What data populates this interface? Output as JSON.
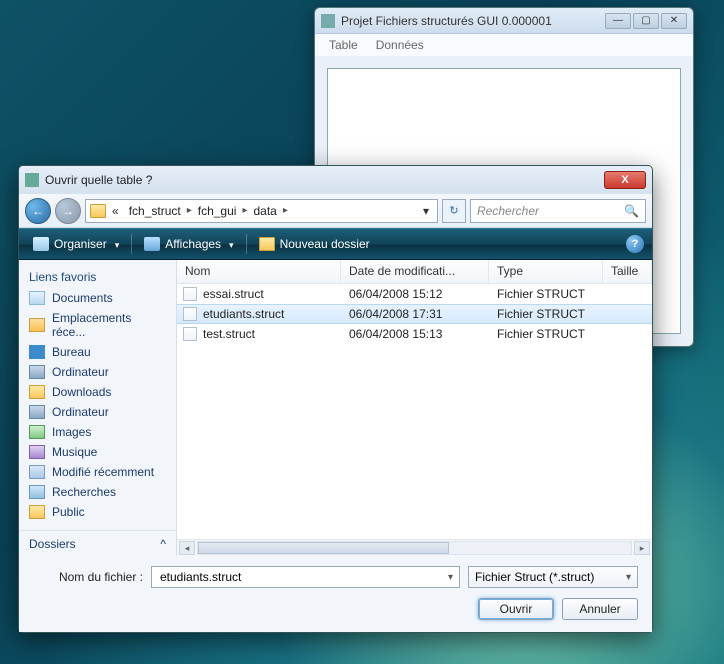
{
  "bg_window": {
    "title": "Projet Fichiers structurés GUI 0.000001",
    "menu_table": "Table",
    "menu_donnees": "Données"
  },
  "dialog": {
    "title": "Ouvrir quelle table ?",
    "breadcrumbs": {
      "pre": "«",
      "p1": "fch_struct",
      "p2": "fch_gui",
      "p3": "data"
    },
    "search_placeholder": "Rechercher",
    "toolbar": {
      "org": "Organiser",
      "views": "Affichages",
      "newfolder": "Nouveau dossier"
    },
    "fav_header": "Liens favoris",
    "favorites": [
      {
        "label": "Documents",
        "ico": "ico-doc"
      },
      {
        "label": "Emplacements réce...",
        "ico": "ico-loc"
      },
      {
        "label": "Bureau",
        "ico": "ico-desk"
      },
      {
        "label": "Ordinateur",
        "ico": "ico-pc"
      },
      {
        "label": "Downloads",
        "ico": "ico-dl"
      },
      {
        "label": "Ordinateur",
        "ico": "ico-pc"
      },
      {
        "label": "Images",
        "ico": "ico-img"
      },
      {
        "label": "Musique",
        "ico": "ico-mus"
      },
      {
        "label": "Modifié récemment",
        "ico": "ico-rec"
      },
      {
        "label": "Recherches",
        "ico": "ico-srch"
      },
      {
        "label": "Public",
        "ico": "ico-pub"
      }
    ],
    "dossiers": "Dossiers",
    "columns": {
      "name": "Nom",
      "date": "Date de modificati...",
      "type": "Type",
      "size": "Taille"
    },
    "files": [
      {
        "name": "essai.struct",
        "date": "06/04/2008 15:12",
        "type": "Fichier STRUCT",
        "selected": false
      },
      {
        "name": "etudiants.struct",
        "date": "06/04/2008 17:31",
        "type": "Fichier STRUCT",
        "selected": true
      },
      {
        "name": "test.struct",
        "date": "06/04/2008 15:13",
        "type": "Fichier STRUCT",
        "selected": false
      }
    ],
    "filename_label": "Nom du fichier :",
    "filename_value": "etudiants.struct",
    "filter_label": "Fichier Struct (*.struct)",
    "open_label": "Ouvrir",
    "cancel_label": "Annuler"
  }
}
